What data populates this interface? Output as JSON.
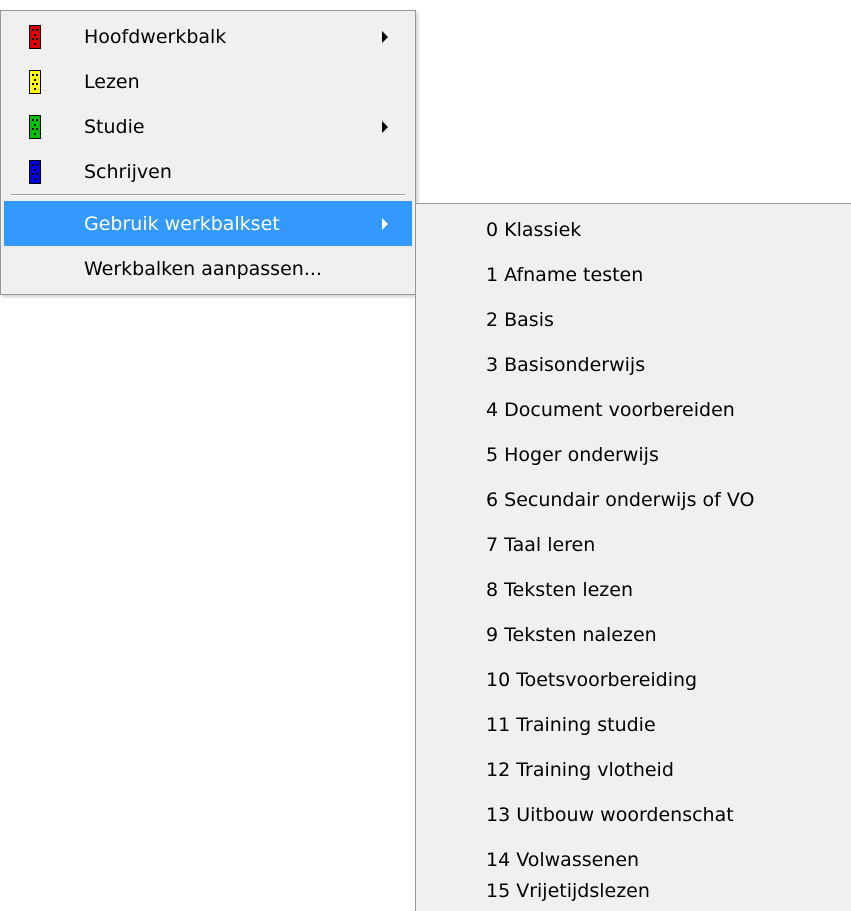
{
  "main_menu": {
    "items": [
      {
        "label": "Hoofdwerkbalk",
        "icon": "toolbar-red-icon",
        "color": "#e00000",
        "submenu": true
      },
      {
        "label": "Lezen",
        "icon": "toolbar-yellow-icon",
        "color": "#ffff00",
        "submenu": false
      },
      {
        "label": "Studie",
        "icon": "toolbar-green-icon",
        "color": "#00c000",
        "submenu": true
      },
      {
        "label": "Schrijven",
        "icon": "toolbar-blue-icon",
        "color": "#0000e0",
        "submenu": false
      }
    ],
    "use_toolbarset_label": "Gebruik werkbalkset",
    "customize_label": "Werkbalken aanpassen..."
  },
  "toolbarset_menu": {
    "items": [
      "0 Klassiek",
      "1 Afname testen",
      "2 Basis",
      "3 Basisonderwijs",
      "4 Document voorbereiden",
      "5 Hoger onderwijs",
      "6 Secundair onderwijs of VO",
      "7 Taal leren",
      "8 Teksten lezen",
      "9 Teksten nalezen",
      "10 Toetsvoorbereiding",
      "11 Training studie",
      "12 Training vlotheid",
      "13 Uitbouw woordenschat",
      "14 Volwassenen",
      "15 Vrijetijdslezen"
    ]
  },
  "colors": {
    "highlight": "#3399ff",
    "menu_background": "#f0f0f0"
  }
}
